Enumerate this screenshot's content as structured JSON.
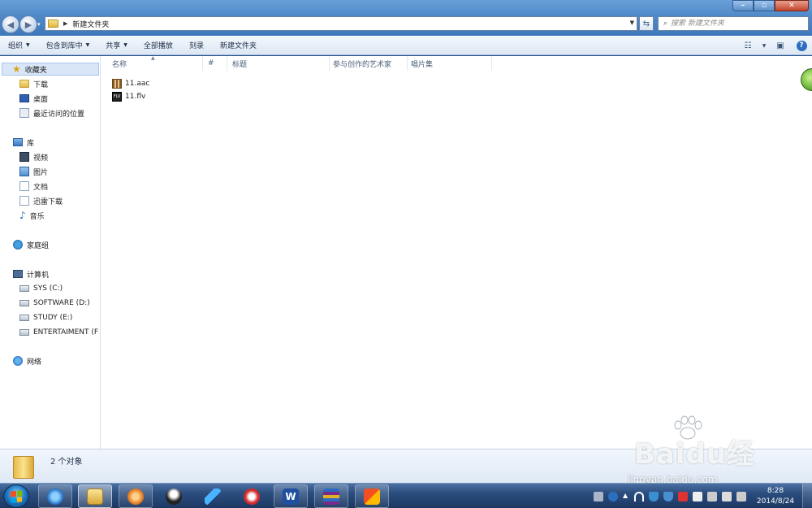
{
  "window": {
    "title": "新建文件夹",
    "search_placeholder": "搜索 新建文件夹"
  },
  "toolbar": {
    "organize": "组织",
    "include_in_library": "包含到库中",
    "share": "共享",
    "play_all": "全部播放",
    "burn": "刻录",
    "new_folder": "新建文件夹"
  },
  "nav": {
    "favorites": "收藏夹",
    "downloads": "下载",
    "desktop": "桌面",
    "recent": "最近访问的位置",
    "libraries": "库",
    "videos": "视频",
    "pictures": "图片",
    "documents": "文档",
    "xunlei": "迅雷下载",
    "music": "音乐",
    "homegroup": "家庭组",
    "computer": "计算机",
    "drive_c": "SYS (C:)",
    "drive_d": "SOFTWARE (D:)",
    "drive_e": "STUDY (E:)",
    "drive_f": "ENTERTAIMENT (F",
    "network": "网络"
  },
  "columns": [
    "名称",
    "#",
    "标题",
    "参与创作的艺术家",
    "唱片集"
  ],
  "files": [
    {
      "name": "11.aac",
      "icon": "aac-file-icon"
    },
    {
      "name": "11.flv",
      "icon": "flv-file-icon"
    }
  ],
  "details": {
    "count": "2 个对象"
  },
  "watermark": {
    "brand": "Baidu经验",
    "url": "jingyan.baidu.com"
  },
  "taskbar": {
    "time": "8:28",
    "date": "2014/8/24"
  }
}
